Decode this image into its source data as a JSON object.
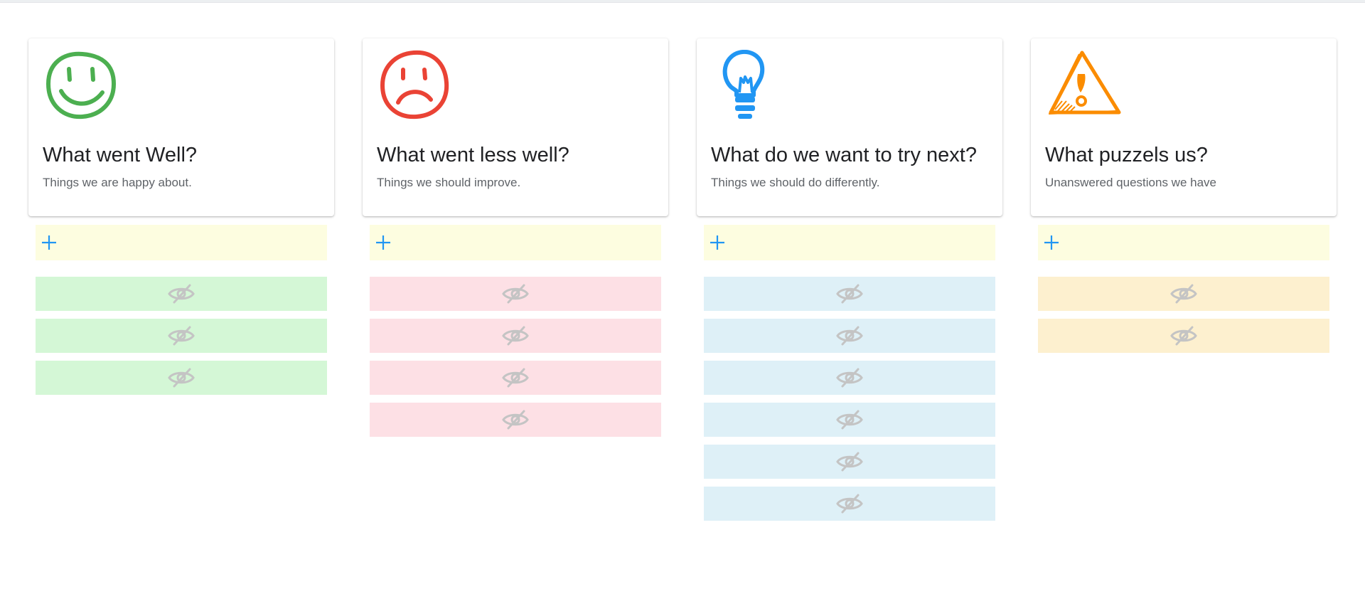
{
  "columns": [
    {
      "id": "well",
      "icon": "smiley-face-icon",
      "title": "What went Well?",
      "subtitle": "Things we are happy about.",
      "icon_color": "#4caf50",
      "note_color": "#d4f7d6",
      "hidden_notes": 3
    },
    {
      "id": "less-well",
      "icon": "sad-face-icon",
      "title": "What went less well?",
      "subtitle": "Things we should improve.",
      "icon_color": "#ea4335",
      "note_color": "#fde0e5",
      "hidden_notes": 4
    },
    {
      "id": "try-next",
      "icon": "lightbulb-icon",
      "title": "What do we want to try next?",
      "subtitle": "Things we should do differently.",
      "icon_color": "#2196f3",
      "note_color": "#def0f7",
      "hidden_notes": 6
    },
    {
      "id": "puzzles",
      "icon": "warning-triangle-icon",
      "title": "What puzzels us?",
      "subtitle": "Unanswered questions we have",
      "icon_color": "#fb8c00",
      "note_color": "#fdf0cf",
      "hidden_notes": 2
    }
  ],
  "add_row_color": "#fdfde0",
  "plus_color": "#2196f3",
  "hidden_icon": "eye-slash-icon"
}
